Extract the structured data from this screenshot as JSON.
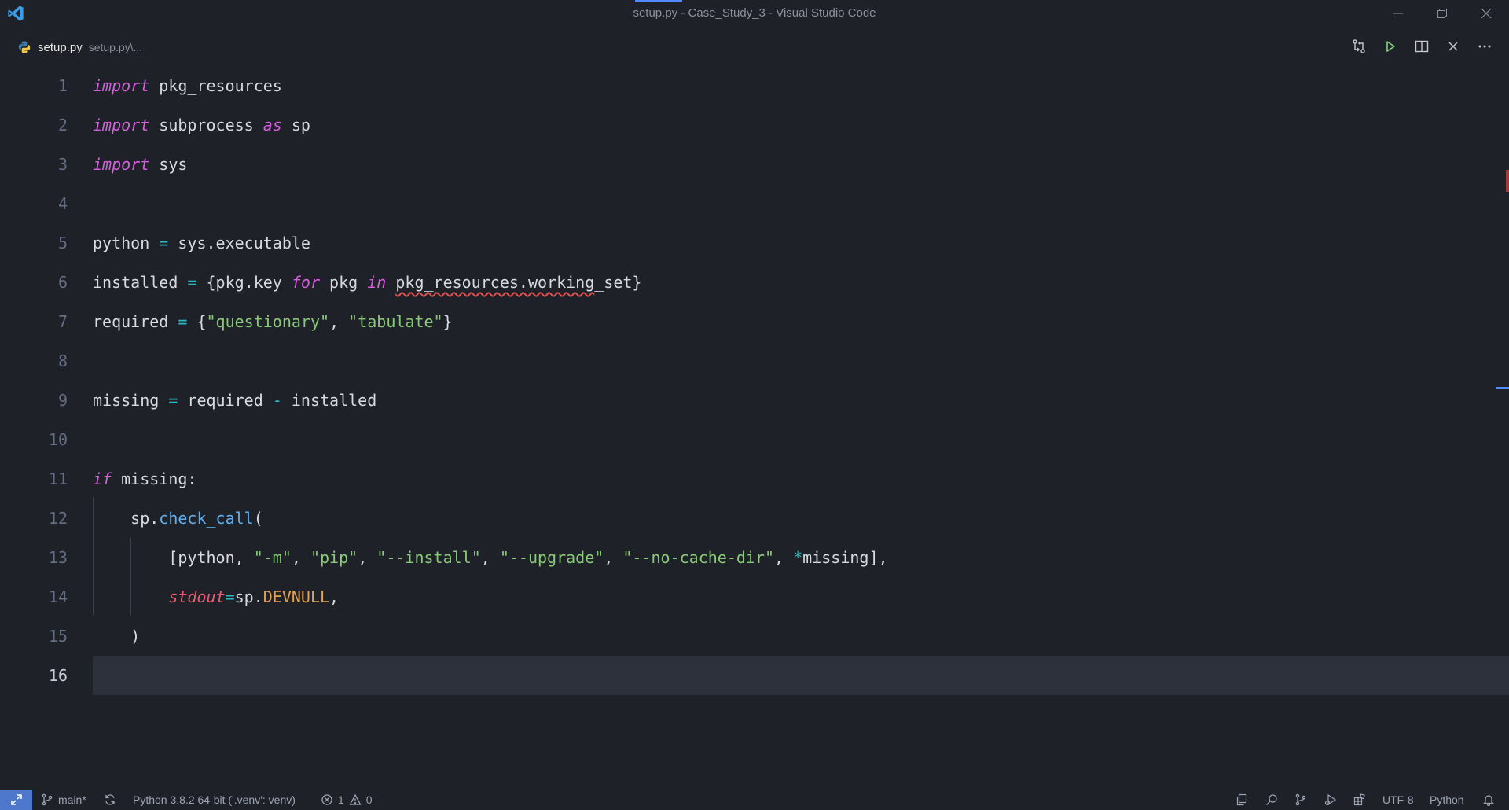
{
  "window": {
    "title": "setup.py - Case_Study_3 - Visual Studio Code"
  },
  "tab": {
    "name": "setup.py",
    "path": "setup.py\\..."
  },
  "editor": {
    "line_numbers": [
      "1",
      "2",
      "3",
      "4",
      "5",
      "6",
      "7",
      "8",
      "9",
      "10",
      "11",
      "12",
      "13",
      "14",
      "15",
      "16"
    ],
    "current_line": "16"
  },
  "statusbar": {
    "branch": "main*",
    "interpreter": "Python 3.8.2 64-bit ('.venv': venv)",
    "errors": "1",
    "warnings": "0",
    "encoding": "UTF-8",
    "language": "Python"
  },
  "colors": {
    "background": "#1e2127",
    "keyword": "#d55fde",
    "string": "#89ca78",
    "operator": "#2bbac5",
    "function": "#61afef",
    "parameter": "#ef596f",
    "constant": "#e5a24f",
    "remote_indicator": "#4d78cc"
  }
}
